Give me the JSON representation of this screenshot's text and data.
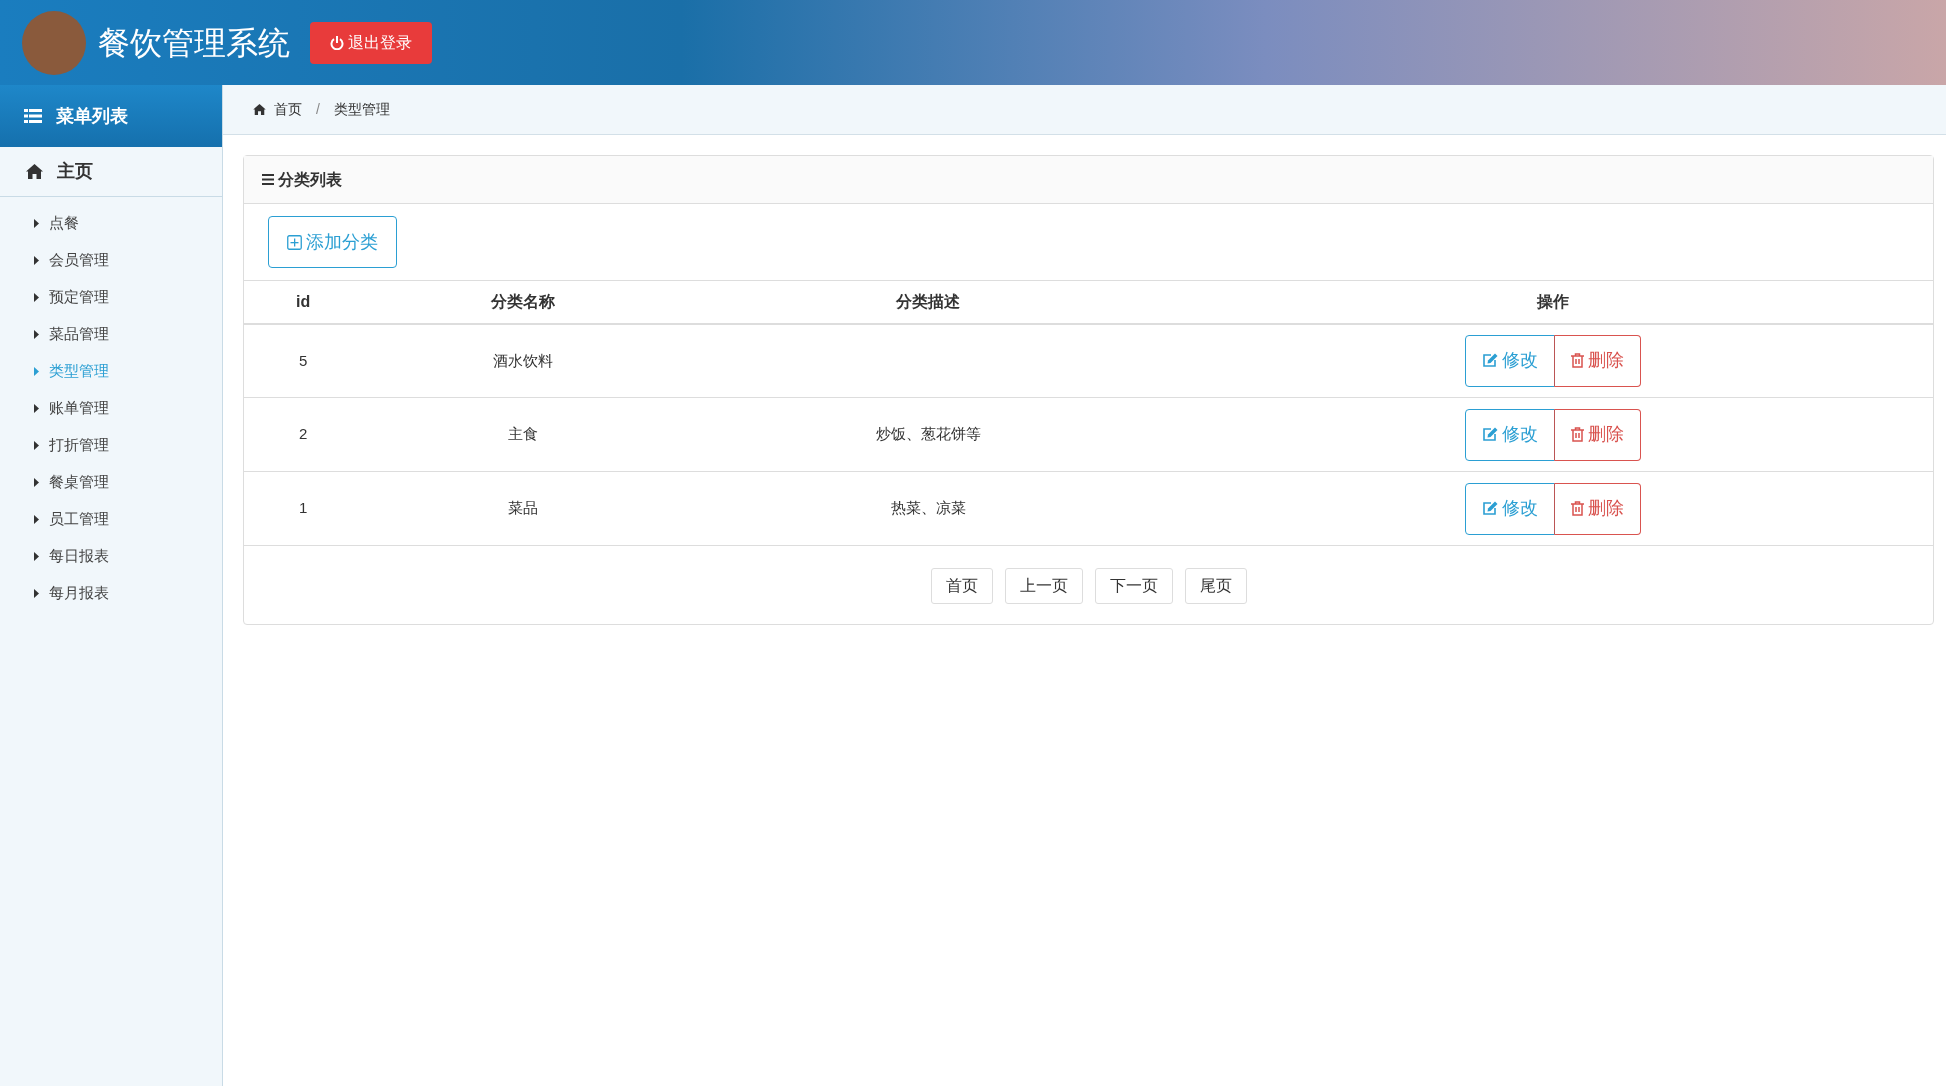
{
  "header": {
    "title": "餐饮管理系统",
    "logout_button": "退出登录"
  },
  "sidebar": {
    "heading": "菜单列表",
    "home": "主页",
    "items": [
      {
        "label": "点餐",
        "selected": false
      },
      {
        "label": "会员管理",
        "selected": false
      },
      {
        "label": "预定管理",
        "selected": false
      },
      {
        "label": "菜品管理",
        "selected": false
      },
      {
        "label": "类型管理",
        "selected": true
      },
      {
        "label": "账单管理",
        "selected": false
      },
      {
        "label": "打折管理",
        "selected": false
      },
      {
        "label": "餐桌管理",
        "selected": false
      },
      {
        "label": "员工管理",
        "selected": false
      },
      {
        "label": "每日报表",
        "selected": false
      },
      {
        "label": "每月报表",
        "selected": false
      }
    ]
  },
  "breadcrumb": [
    "首页",
    "类型管理"
  ],
  "breadcrumb_separator": "/",
  "panel": {
    "title": "分类列表",
    "add_button": "添加分类",
    "table": {
      "columns": [
        "id",
        "分类名称",
        "分类描述",
        "操作"
      ],
      "rows": [
        {
          "id": "5",
          "name": "酒水饮料",
          "edit": "修改",
          "delete": "删除"
        },
        {
          "id": "2",
          "name": "主食",
          "description": "炒饭、葱花饼等",
          "edit": "修改",
          "delete": "删除"
        },
        {
          "id": "1",
          "name": "菜品",
          "description": "热菜、凉菜",
          "edit": "修改",
          "delete": "删除"
        }
      ]
    },
    "pagination": [
      "首页",
      "上一页",
      "下一页",
      "尾页"
    ]
  }
}
